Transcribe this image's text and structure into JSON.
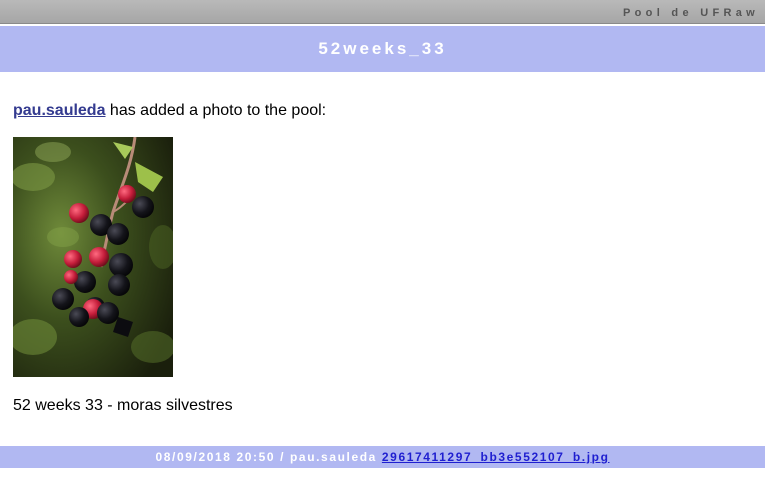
{
  "header": {
    "pool_name": "Pool de UFRaw",
    "title": "52weeks_33"
  },
  "post": {
    "user": "pau.sauleda",
    "action_text": " has added a photo to the pool:",
    "caption": "52 weeks 33 - moras silvestres"
  },
  "footer": {
    "meta": "08/09/2018 20:50 / pau.sauleda ",
    "file_link": "29617411297_bb3e552107_b.jpg"
  },
  "colors": {
    "header_bar": "#b1b8f2",
    "top_bar": "#a6a6a6",
    "link": "#333a8f",
    "footer_link": "#1f1fd0"
  }
}
